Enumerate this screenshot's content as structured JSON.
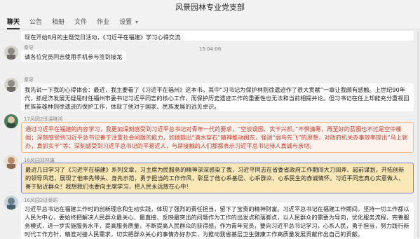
{
  "window": {
    "title": "风景园林专业党支部"
  },
  "tabs": [
    {
      "label": "聊天",
      "active": true
    },
    {
      "label": "公告"
    },
    {
      "label": "相册"
    },
    {
      "label": "文件"
    },
    {
      "label": "作业"
    },
    {
      "label": "设置",
      "has_dropdown": true
    }
  ],
  "messages": [
    {
      "sender": "",
      "text": "现在开始8月的主题党日活动，《习近平在福建》学习心得交流"
    },
    {
      "sender": "秦导",
      "text": "请各位党员同志使用手机参与签到接龙"
    },
    {
      "timestamp": "15:04:06"
    },
    {
      "sender": "秦导",
      "text": "我先说一下我的心得体会：最近，我主要看了《习近平在福州》这本书。其中“习书记为保护林则徐遗迹作了很大贡献”一章让我颇有感触。上世纪90年代，抓经济发展无疑是时任福州市委书记习近平同志的核心工作，而保护历史遗迹工作的重要性也无法和当前相提并论。但习书记在任上却能充分重视回民族英雄林则徐遗迹的保护工作，体现了他对于国家、民族发展的远见卓识。"
    },
    {
      "sender": "17风园2班温琳鸿",
      "text": "通过习近平在福建的内容学习，我更加深刻感受到习近平总书记对青年一代的要求，“空谈误国、实干兴邦。”不惧清寒，再至好的蓝图也不过是空中楼阁；深刻感受到习近平总书记善于注重社会问题的能力，如他提出“滴水穿石”精神推动闽东，强调“弱鸟先飞”的思想，对政府机关办事效率提出“马上就办，真抓实干”等；深刻感受到习近平总书记的平易近人，与耕接触的人们都都表示习近平总书记待人真诚与亲切。"
    },
    {
      "sender": "16风园邓林骥",
      "text": "最近几日学习了《习近平在福建》系列文章，习主席为民服务的精神深深感染了我，习近平同志在省委省政府工作期间大刀阔斧、超前谋划，开拓创新的领导风范，展现了他率先带头、身先示范，勇于担当的工作作风，彰显了他心系基层、心系群众、心系民生的赤诚情怀。习近平同志真心实意做人、善于贴近群众！我想我们也要向主席学习，把人民永远放在心中！"
    },
    {
      "sender": "16风园2班黄昭",
      "text": "习近平总书记在福建工作时的创新理念和生动实践，体现了强烈的责任担当，留下了宝贵的精神财富。习近平总书记在福建工作期间，坚持一切工作都以人民为中心，要始终把解决人民群众最关心、最直接、反映最突出的问题作为工作的出发点和落脚点，以人民群众的需要为导向，优化服务流程，完善服务模式，进一步实施服务水平，提高服务质量，不断提高人民群众的获得感。作为青年党员，要向习近平总书记学习，心系人民，勇于担当，努力践行新时代工作方针，精准对接人民需求，切实把群众关心的事情办好办实，为推动我省基层卫生健康工作高质量发展贡献作出自己的贡献。"
    }
  ],
  "colors": {
    "red_text": "#c43c2c",
    "yellow_bg": "#fbe8b6",
    "purple_border": "#7b7bd6",
    "orange_border": "#f0b98a"
  }
}
